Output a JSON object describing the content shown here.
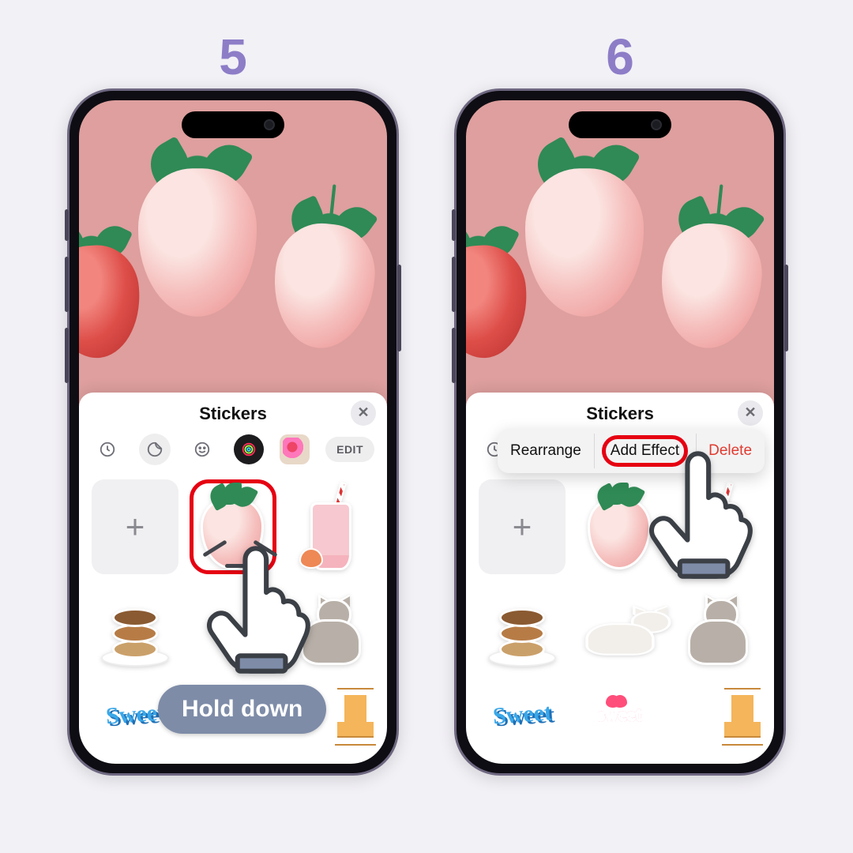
{
  "steps": {
    "left_number": "5",
    "right_number": "6"
  },
  "drawer": {
    "title": "Stickers",
    "close_symbol": "✕",
    "edit_label": "EDIT",
    "plus_symbol": "+"
  },
  "context_menu": {
    "rearrange": "Rearrange",
    "add_effect": "Add Effect",
    "delete": "Delete"
  },
  "badge": {
    "hold_down": "Hold down"
  },
  "stickers": {
    "sweet1": "Sweet",
    "sweet2": "sweet"
  },
  "tabs": {
    "t1": "recents",
    "t2": "stickers",
    "t3": "emoji",
    "t4": "app1",
    "t5": "app2"
  },
  "colors": {
    "accent": "#8d7dc7",
    "highlight": "#e60012",
    "badge": "#7e8ca8",
    "delete": "#e13a2f"
  }
}
